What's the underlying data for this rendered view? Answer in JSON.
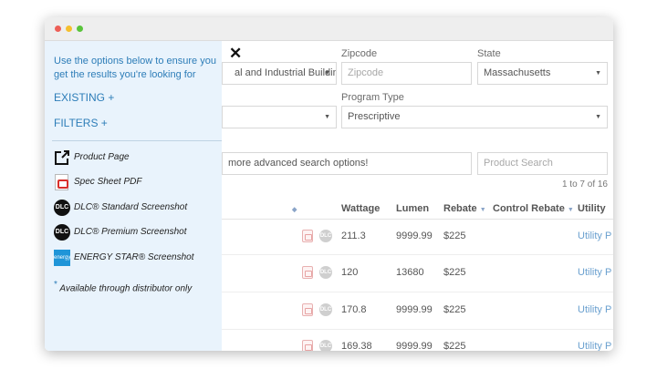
{
  "filters": {
    "zipcode_label": "Zipcode",
    "state_label": "State",
    "program_type_label": "Program Type",
    "sector_value": "al and Industrial Buildings",
    "zipcode_placeholder": "Zipcode",
    "state_value": "Massachusetts",
    "program_type_value": "Prescriptive",
    "advanced_search_text": "more advanced search options!",
    "product_search_placeholder": "Product Search",
    "close_icon": "close-icon"
  },
  "results": {
    "count_text": "1 to 7 of 16",
    "columns": [
      "Wattage",
      "Lumen",
      "Rebate",
      "Control Rebate",
      "Utility"
    ],
    "rows": [
      {
        "wattage": "211.3",
        "lumen": "9999.99",
        "rebate": "$225",
        "utility": "Utility P"
      },
      {
        "wattage": "120",
        "lumen": "13680",
        "rebate": "$225",
        "utility": "Utility P"
      },
      {
        "wattage": "170.8",
        "lumen": "9999.99",
        "rebate": "$225",
        "utility": "Utility P"
      },
      {
        "wattage": "169.38",
        "lumen": "9999.99",
        "rebate": "$225",
        "utility": "Utility P"
      }
    ],
    "row_icon_text": "DLC"
  },
  "sidebar": {
    "intro": "Use the options below to ensure you get the results you're looking for",
    "existing_label": "EXISTING +",
    "filters_label": "FILTERS +",
    "legend": [
      {
        "icon": "external-link-icon",
        "label": "Product Page"
      },
      {
        "icon": "pdf-icon",
        "label": "Spec Sheet PDF"
      },
      {
        "icon": "dlc-standard-icon",
        "label": "DLC® Standard Screenshot",
        "icon_text": "DLC"
      },
      {
        "icon": "dlc-premium-icon",
        "label": "DLC® Premium Screenshot",
        "icon_text": "DLC"
      },
      {
        "icon": "energy-star-icon",
        "label": "ENERGY STAR® Screenshot",
        "icon_text": "energy"
      }
    ],
    "footnote_mark": "*",
    "footnote": "Available through distributor only"
  },
  "colors": {
    "accent": "#2d7db8",
    "sidebar_bg": "#e9f3fc",
    "link": "#6aa0cf"
  }
}
